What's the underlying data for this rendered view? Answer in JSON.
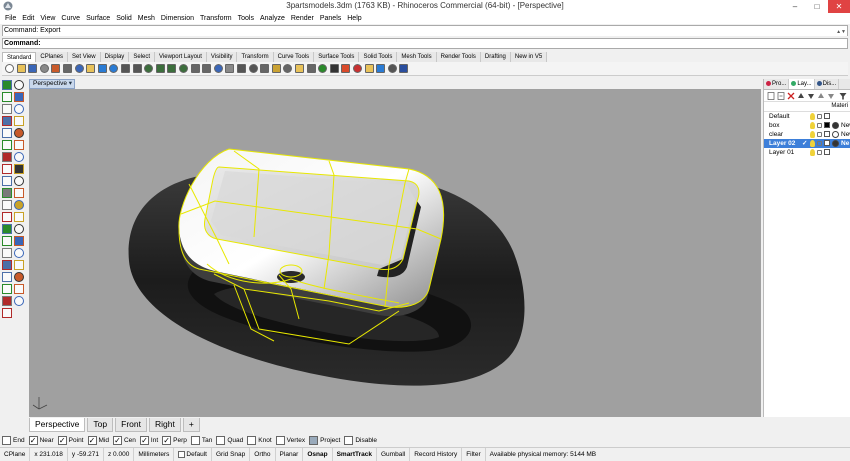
{
  "window": {
    "title": "3partsmodels.3dm (1763 KB) - Rhinoceros Commercial (64-bit) - [Perspective]",
    "minimize_glyph": "–",
    "maximize_glyph": "□",
    "close_glyph": "✕"
  },
  "menu": [
    "File",
    "Edit",
    "View",
    "Curve",
    "Surface",
    "Solid",
    "Mesh",
    "Dimension",
    "Transform",
    "Tools",
    "Analyze",
    "Render",
    "Panels",
    "Help"
  ],
  "command": {
    "history": "Command: Export",
    "prompt": "Command:"
  },
  "toolbar_tabs": [
    "Standard",
    "CPlanes",
    "Set View",
    "Display",
    "Select",
    "Viewport Layout",
    "Visibility",
    "Transform",
    "Curve Tools",
    "Surface Tools",
    "Solid Tools",
    "Mesh Tools",
    "Render Tools",
    "Drafting",
    "New in V5"
  ],
  "viewport": {
    "label": "Perspective",
    "background": "#a0a0a0",
    "selection_color": "#e8e800",
    "axis_labels": {
      "x": "x",
      "y": "y",
      "z": "z"
    }
  },
  "viewport_tabs": [
    "Perspective",
    "Top",
    "Front",
    "Right",
    "+"
  ],
  "osnaps": [
    {
      "label": "End",
      "checked": false
    },
    {
      "label": "Near",
      "checked": true
    },
    {
      "label": "Point",
      "checked": true
    },
    {
      "label": "Mid",
      "checked": true
    },
    {
      "label": "Cen",
      "checked": true
    },
    {
      "label": "Int",
      "checked": true
    },
    {
      "label": "Perp",
      "checked": true
    },
    {
      "label": "Tan",
      "checked": false
    },
    {
      "label": "Quad",
      "checked": false
    },
    {
      "label": "Knot",
      "checked": false
    },
    {
      "label": "Vertex",
      "checked": false
    },
    {
      "label": "Project",
      "checked": false
    },
    {
      "label": "Disable",
      "checked": false
    }
  ],
  "status": {
    "cplane": "CPlane",
    "x": "x 231.018",
    "y": "y -59.271",
    "z": "z 0.000",
    "units": "Millimeters",
    "layer": "Default",
    "grid_snap": "Grid Snap",
    "ortho": "Ortho",
    "planar": "Planar",
    "osnap": "Osnap",
    "smarttrack": "SmartTrack",
    "gumball": "Gumball",
    "record_history": "Record History",
    "filter": "Filter",
    "memory": "Available physical memory: 5144 MB"
  },
  "panel": {
    "tabs": [
      "Pro...",
      "Lay...",
      "Dis..."
    ],
    "material_header": "Materi",
    "layers": [
      {
        "name": "Default",
        "color": "#ffffff",
        "material_color": null,
        "material_name": "",
        "current": false
      },
      {
        "name": "box",
        "color": "#000000",
        "material_color": "#333333",
        "material_name": "New",
        "current": false
      },
      {
        "name": "clear",
        "color": "#ffffff",
        "material_color": "#ffffff",
        "material_name": "New",
        "current": false
      },
      {
        "name": "Layer 02",
        "color": "#ffffff",
        "material_color": "#333333",
        "material_name": "Ne",
        "current": true,
        "check": "✓"
      },
      {
        "name": "Layer 01",
        "color": "#ffffff",
        "material_color": null,
        "material_name": "",
        "current": false
      }
    ]
  }
}
